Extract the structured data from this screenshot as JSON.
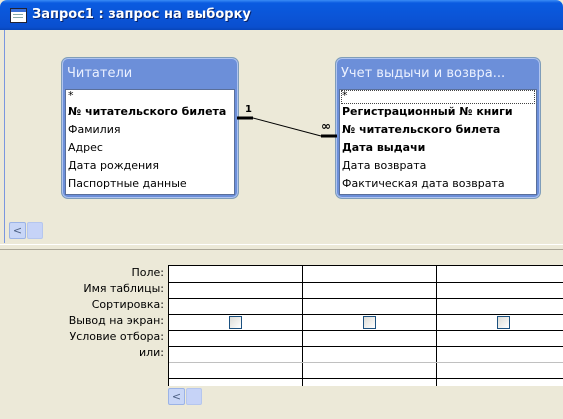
{
  "window": {
    "title": "Запрос1 : запрос на выборку"
  },
  "tables": [
    {
      "title": "Читатели",
      "fields": [
        {
          "label": "*",
          "bold": false
        },
        {
          "label": "№ читательского билета",
          "bold": true
        },
        {
          "label": "Фамилия",
          "bold": false
        },
        {
          "label": "Адрес",
          "bold": false
        },
        {
          "label": "Дата рождения",
          "bold": false
        },
        {
          "label": "Паспортные данные",
          "bold": false
        }
      ]
    },
    {
      "title": "Учет выдычи и возвра...",
      "fields": [
        {
          "label": "*",
          "bold": false
        },
        {
          "label": "Регистрационный № книги",
          "bold": true
        },
        {
          "label": "№ читательского билета",
          "bold": true
        },
        {
          "label": "Дата выдачи",
          "bold": true
        },
        {
          "label": "Дата возврата",
          "bold": false
        },
        {
          "label": "Фактическая дата возврата",
          "bold": false
        }
      ]
    }
  ],
  "relationship": {
    "one_label": "1",
    "many_label": "∞"
  },
  "scroll": {
    "left_arrow": "<"
  },
  "grid": {
    "row_labels": [
      "Поле:",
      "Имя таблицы:",
      "Сортировка:",
      "Вывод на экран:",
      "Условие отбора:",
      "или:"
    ],
    "show_checked": [
      false,
      false,
      false
    ]
  }
}
